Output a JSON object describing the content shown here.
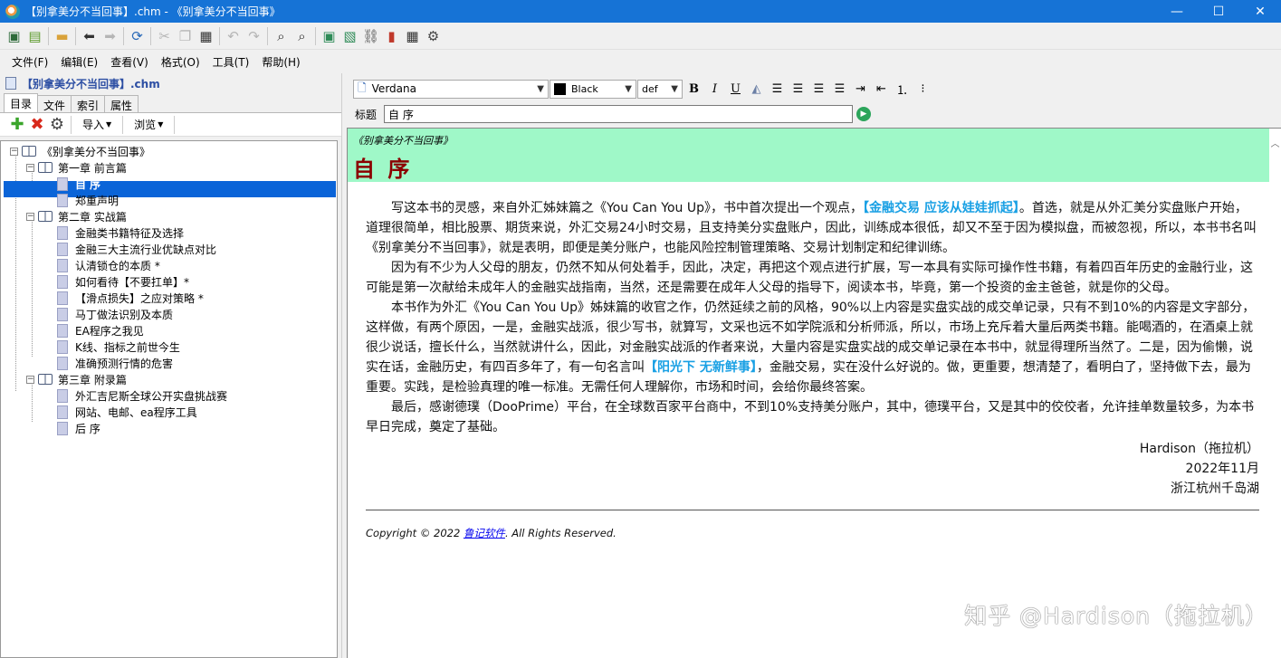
{
  "window": {
    "title": "【别拿美分不当回事】.chm - 《别拿美分不当回事》",
    "minimize": "—",
    "maximize": "☐",
    "close": "✕"
  },
  "menu": [
    "文件(F)",
    "编辑(E)",
    "查看(V)",
    "格式(O)",
    "工具(T)",
    "帮助(H)"
  ],
  "left": {
    "file": "【别拿美分不当回事】.chm",
    "tabs": [
      "目录",
      "文件",
      "索引",
      "属性"
    ],
    "active_tab": "目录",
    "import_label": "导入",
    "browse_label": "浏览",
    "tree": {
      "root": "《别拿美分不当回事》",
      "ch1": "第一章 前言篇",
      "ch1_items": [
        "自 序",
        "郑重声明"
      ],
      "ch2": "第二章 实战篇",
      "ch2_items": [
        "金融类书籍特征及选择",
        "金融三大主流行业优缺点对比",
        "认清锁仓的本质 *",
        "如何看待【不要扛单】*",
        "【滑点损失】之应对策略 *",
        "马丁做法识别及本质",
        "EA程序之我见",
        "K线、指标之前世今生",
        "准确预测行情的危害"
      ],
      "ch3": "第三章 附录篇",
      "ch3_items": [
        "外汇吉尼斯全球公开实盘挑战赛",
        "网站、电邮、ea程序工具",
        "后 序"
      ]
    }
  },
  "format": {
    "font": "Verdana",
    "color": "Black",
    "size": "def",
    "bold": "B",
    "italic": "I",
    "underline": "U"
  },
  "title_field": {
    "label": "标题",
    "value": "自 序"
  },
  "doc": {
    "book_title": "《别拿美分不当回事》",
    "chapter": "自 序",
    "p1_a": "写这本书的灵感，来自外汇姊妹篇之《You Can You Up》，书中首次提出一个观点，",
    "p1_hl": "【金融交易 应该从娃娃抓起】",
    "p1_b": "。首选，就是从外汇美分实盘账户开始，道理很简单，相比股票、期货来说，外汇交易24小时交易，且支持美分实盘账户，因此，训练成本很低，却又不至于因为模拟盘，而被忽视，所以，本书书名叫《别拿美分不当回事》，就是表明，即便是美分账户，也能风险控制管理策略、交易计划制定和纪律训练。",
    "p2": "因为有不少为人父母的朋友，仍然不知从何处着手，因此，决定，再把这个观点进行扩展，写一本具有实际可操作性书籍，有着四百年历史的金融行业，这可能是第一次献给未成年人的金融实战指南，当然，还是需要在成年人父母的指导下，阅读本书，毕竟，第一个投资的金主爸爸，就是你的父母。",
    "p3_a": "本书作为外汇《You Can You Up》姊妹篇的收官之作，仍然延续之前的风格，90%以上内容是实盘实战的成交单记录，只有不到10%的内容是文字部分，这样做，有两个原因，一是，金融实战派，很少写书，就算写，文采也远不如学院派和分析师派，所以，市场上充斥着大量后两类书籍。能喝酒的，在酒桌上就很少说话，擅长什么，当然就讲什么，因此，对金融实战派的作者来说，大量内容是实盘实战的成交单记录在本书中，就显得理所当然了。二是，因为偷懒，说实在话，金融历史，有四百多年了，有一句名言叫",
    "p3_hl": "【阳光下 无新鲜事】",
    "p3_b": "，金融交易，实在没什么好说的。做，更重要，想清楚了，看明白了，坚持做下去，最为重要。实践，是检验真理的唯一标准。无需任何人理解你，市场和时间，会给你最终答案。",
    "p4": "最后，感谢德璞（DooPrime）平台，在全球数百家平台商中，不到10%支持美分账户，其中，德璞平台，又是其中的佼佼者，允许挂单数量较多，为本书早日完成，奠定了基础。",
    "sign_name": "Hardison（拖拉机）",
    "sign_date": "2022年11月",
    "sign_place": "浙江杭州千岛湖",
    "copyright_a": "Copyright © 2022 ",
    "copyright_link": "鲁记软件",
    "copyright_b": ". All Rights Reserved."
  },
  "watermark": "知乎 @Hardison（拖拉机）"
}
